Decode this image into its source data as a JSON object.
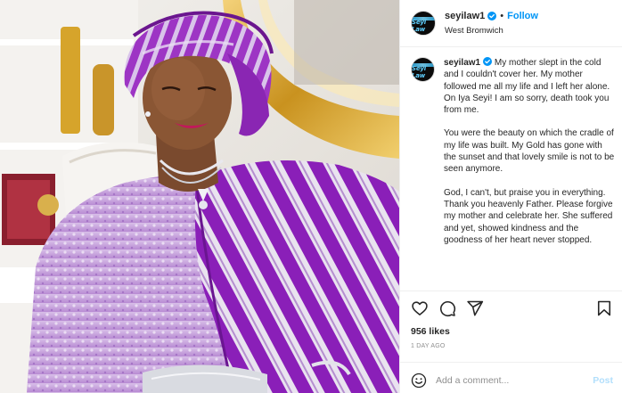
{
  "post": {
    "username": "seyilaw1",
    "follow_label": "Follow",
    "separator": "•",
    "location": "West Bromwich",
    "verified_icon": "verified-badge-icon",
    "avatar_text": "Seyi Law"
  },
  "caption": {
    "username": "seyilaw1",
    "paragraphs": [
      "My mother slept in the cold and I couldn't cover her. My mother followed me all my life and I left her alone. On Iya Seyi! I am so sorry, death took you from me.",
      "You were the beauty on which the cradle of my life was built. My Gold has gone with the sunset and that lovely smile is not to be seen anymore.",
      "God, I can't, but praise you in everything. Thank you heavenly Father. Please forgive my mother and celebrate her. She suffered and yet, showed kindness and the goodness of her heart never stopped."
    ]
  },
  "actions": {
    "like_icon": "heart-icon",
    "comment_icon": "comment-icon",
    "share_icon": "share-icon",
    "save_icon": "bookmark-icon"
  },
  "likes_text": "956 likes",
  "time_text": "1 DAY AGO",
  "comment": {
    "placeholder": "Add a comment...",
    "post_label": "Post",
    "emoji_icon": "emoji-icon"
  },
  "colors": {
    "link_blue": "#0095f6",
    "post_disabled": "#b2dffc",
    "gele_purple": "#9b2fc0",
    "lace_lilac": "#c7a4dd"
  }
}
